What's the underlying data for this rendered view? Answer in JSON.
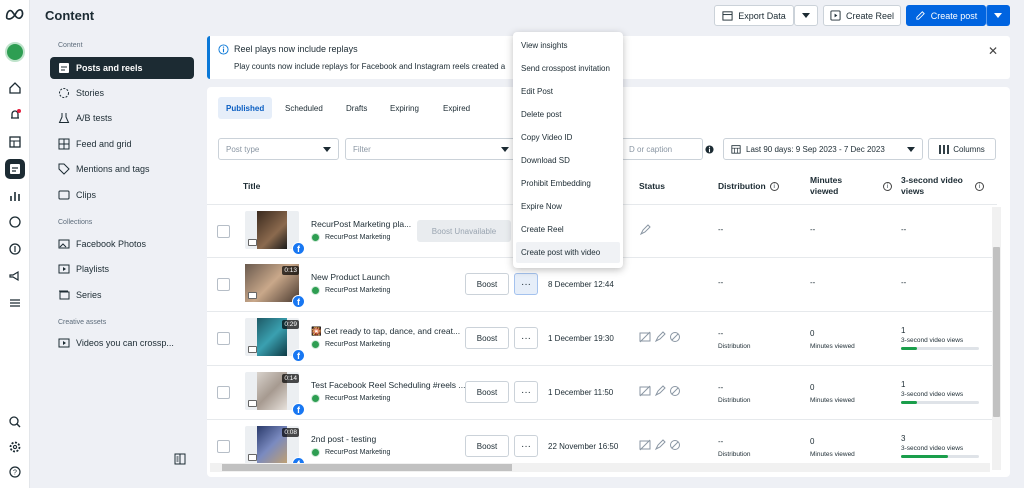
{
  "app": {
    "logo_icon": "meta-logo-icon",
    "page_title": "Content"
  },
  "rail": [
    "home-icon",
    "notifications-icon",
    "planner-icon",
    "content-icon",
    "insights-icon",
    "inbox-icon",
    "monetization-icon",
    "ads-icon",
    "menu-icon",
    "search-icon",
    "settings-icon",
    "help-icon"
  ],
  "sidebar": {
    "content_label": "Content",
    "content_items": [
      {
        "label": "Posts and reels",
        "icon": "posts-icon"
      },
      {
        "label": "Stories",
        "icon": "stories-icon"
      },
      {
        "label": "A/B tests",
        "icon": "flask-icon"
      },
      {
        "label": "Feed and grid",
        "icon": "grid-icon"
      },
      {
        "label": "Mentions and tags",
        "icon": "tag-icon"
      },
      {
        "label": "Clips",
        "icon": "clips-icon"
      }
    ],
    "collections_label": "Collections",
    "collection_items": [
      {
        "label": "Facebook Photos",
        "icon": "photos-icon"
      },
      {
        "label": "Playlists",
        "icon": "playlist-icon"
      },
      {
        "label": "Series",
        "icon": "series-icon"
      }
    ],
    "creative_label": "Creative assets",
    "creative_items": [
      {
        "label": "Videos you can crossp...",
        "icon": "video-icon"
      }
    ]
  },
  "toolbar": {
    "export_label": "Export Data",
    "create_reel_label": "Create Reel",
    "create_post_label": "Create post"
  },
  "banner": {
    "title": "Reel plays now include replays",
    "body": "Play counts now include replays for Facebook and Instagram reels created a"
  },
  "tabs": [
    "Published",
    "Scheduled",
    "Drafts",
    "Expiring",
    "Expired"
  ],
  "filters": {
    "post_type_placeholder": "Post type",
    "filter_placeholder": "Filter",
    "search_partial": "D or caption",
    "date_range": "Last 90 days: 9 Sep 2023 - 7 Dec 2023",
    "columns_label": "Columns"
  },
  "table": {
    "headers": {
      "title": "Title",
      "status": "Status",
      "distribution": "Distribution",
      "minutes_viewed": "Minutes viewed",
      "three_sec": "3-second video views"
    },
    "rows": [
      {
        "title": "RecurPost Marketing pla...",
        "account": "RecurPost Marketing",
        "duration": "",
        "boost": "Boost Unavailable",
        "date": "",
        "distribution": "--",
        "distribution_label": "",
        "minutes": "--",
        "minutes_label": "",
        "three_sec": "--",
        "three_sec_label": "",
        "three_sec_fill": 0
      },
      {
        "title": "New Product Launch",
        "account": "RecurPost Marketing",
        "duration": "0:13",
        "boost": "Boost",
        "date": "8 December 12:44",
        "distribution": "--",
        "distribution_label": "",
        "minutes": "--",
        "minutes_label": "",
        "three_sec": "--",
        "three_sec_label": "",
        "three_sec_fill": 0
      },
      {
        "title": "Get ready to tap, dance, and creat...",
        "title_prefix": "🎇",
        "account": "RecurPost Marketing",
        "duration": "0:29",
        "boost": "Boost",
        "date": "1 December 19:30",
        "distribution": "--",
        "distribution_label": "Distribution",
        "minutes": "0",
        "minutes_label": "Minutes viewed",
        "three_sec": "1",
        "three_sec_label": "3-second video views",
        "three_sec_fill": 0.2
      },
      {
        "title": "Test Facebook Reel Scheduling #reels ...",
        "account": "RecurPost Marketing",
        "duration": "0:14",
        "boost": "Boost",
        "date": "1 December 11:50",
        "distribution": "--",
        "distribution_label": "Distribution",
        "minutes": "0",
        "minutes_label": "Minutes viewed",
        "three_sec": "1",
        "three_sec_label": "3-second video views",
        "three_sec_fill": 0.2
      },
      {
        "title": "2nd post - testing",
        "account": "RecurPost Marketing",
        "duration": "0:08",
        "boost": "Boost",
        "date": "22 November 16:50",
        "distribution": "--",
        "distribution_label": "Distribution",
        "minutes": "0",
        "minutes_label": "Minutes viewed",
        "three_sec": "3",
        "three_sec_label": "3-second video views",
        "three_sec_fill": 0.6
      }
    ]
  },
  "menu": [
    "View insights",
    "Send crosspost invitation",
    "Edit Post",
    "Delete post",
    "Copy Video ID",
    "Download SD",
    "Prohibit Embedding",
    "Expire Now",
    "Create Reel",
    "Create post with video"
  ],
  "colors": {
    "primary": "#0064e0",
    "accent_dark": "#1c2b33",
    "green": "#1a9e4b"
  }
}
